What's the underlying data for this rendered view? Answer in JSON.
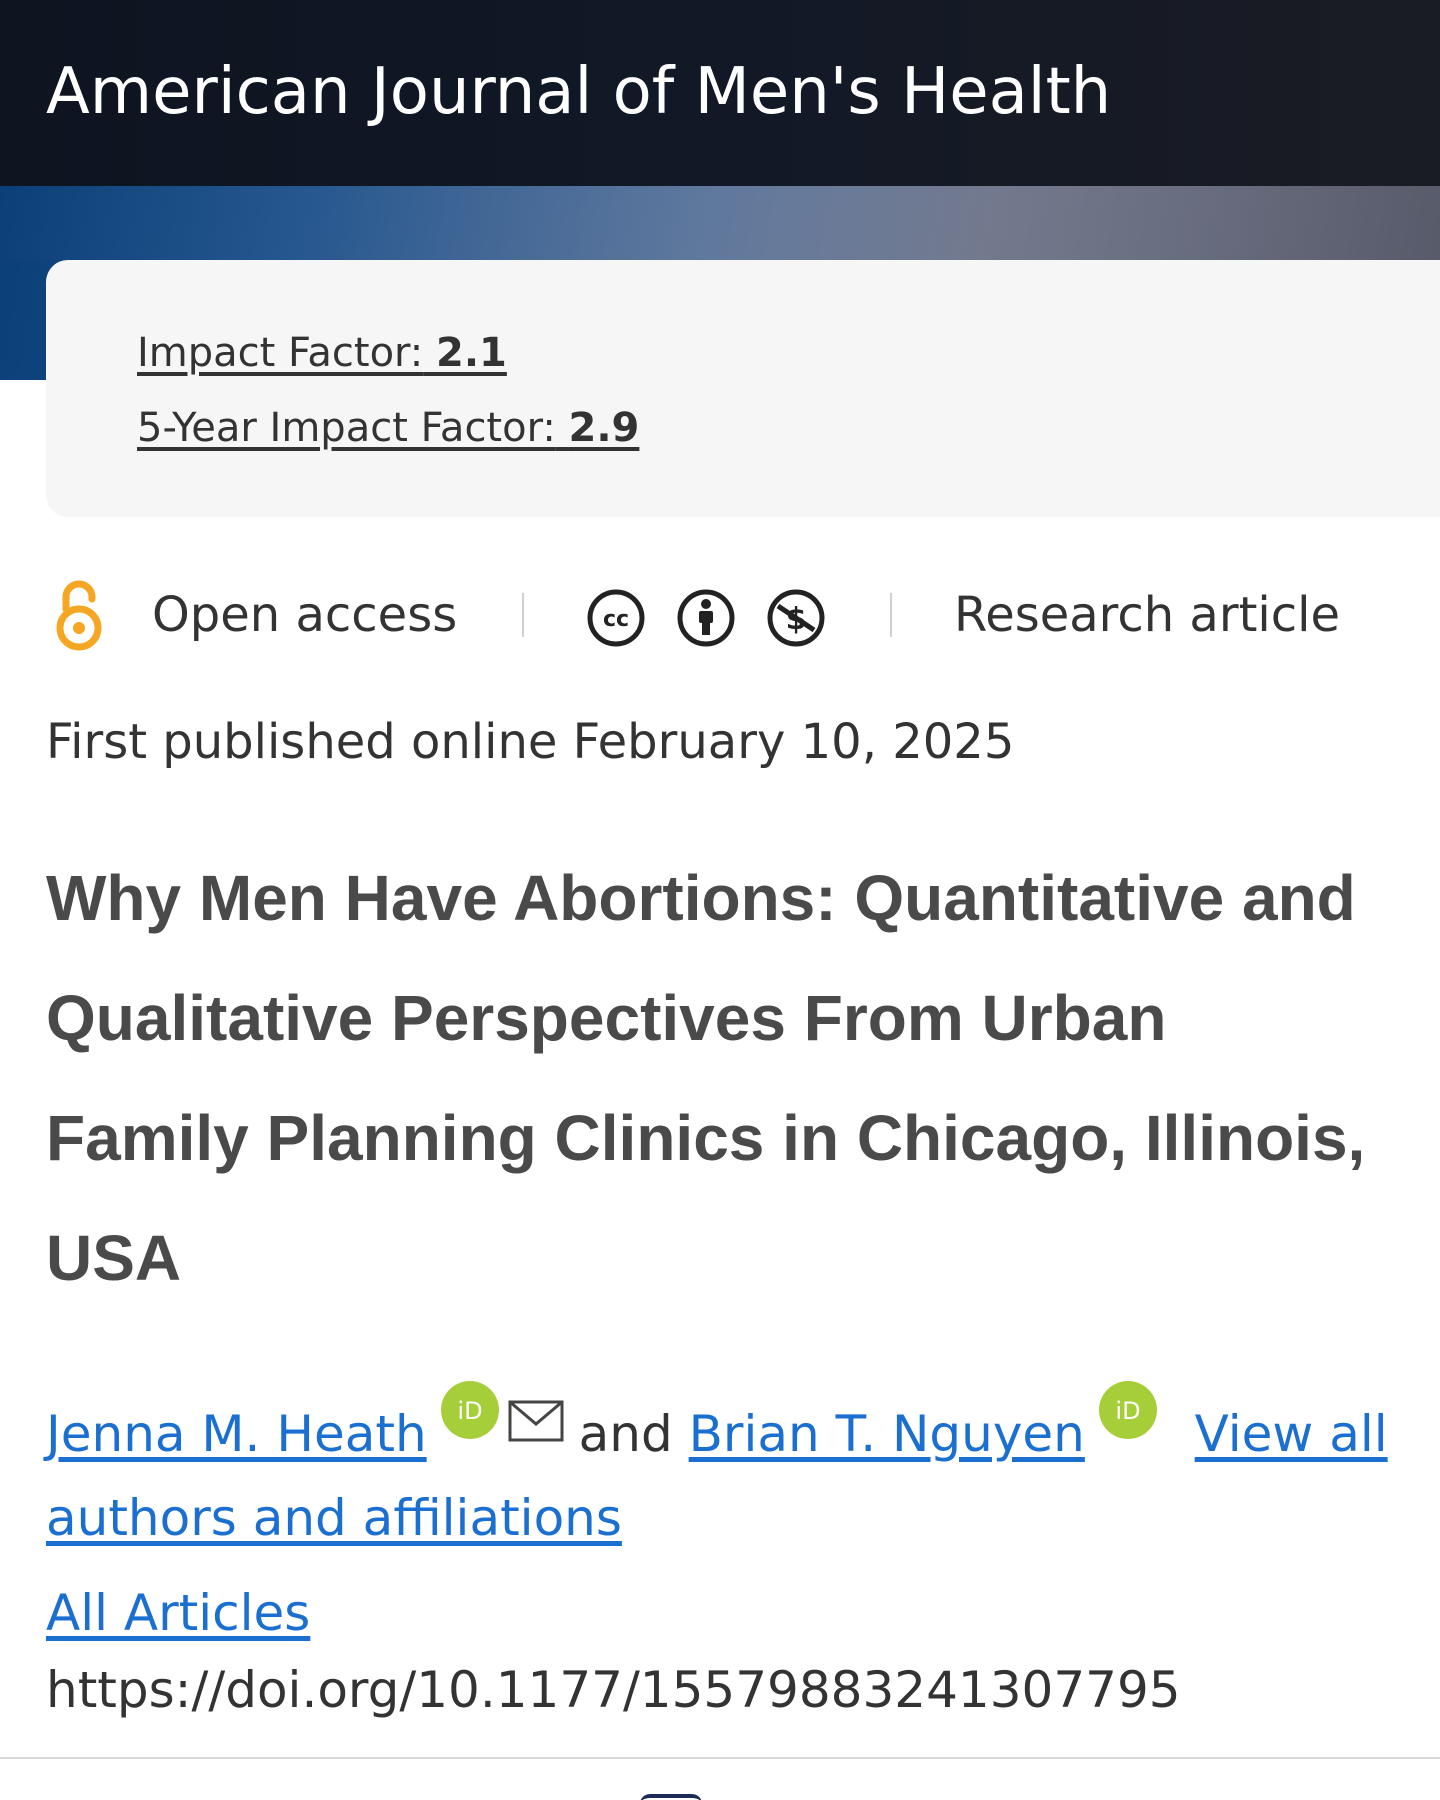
{
  "header": {
    "journal_title": "American Journal of Men's Health"
  },
  "metrics": {
    "impact_factor_label": "Impact Factor:",
    "impact_factor_value": "2.1",
    "five_year_label": "5-Year Impact Factor:",
    "five_year_value": "2.9"
  },
  "access": {
    "open_access_label": "Open access",
    "open_access_icon": "open-access-lock-icon",
    "license_icons": [
      "creative-commons-icon",
      "attribution-icon",
      "non-commercial-icon"
    ],
    "article_type": "Research article"
  },
  "publication": {
    "date_text": "First published online February 10, 2025"
  },
  "article": {
    "title_lines": [
      "Why Men Have Abortions: Quantitative and",
      "Qualitative Perspectives From Urban",
      "Family Planning Clinics in Chicago, Illinois,",
      "USA"
    ]
  },
  "authors": {
    "author_1": "Jenna M. Heath",
    "connector": "and",
    "author_2": "Brian T. Nguyen",
    "view_all_label": "View all authors and affiliations"
  },
  "links": {
    "all_articles": "All Articles",
    "doi": "https://doi.org/10.1177/15579883241307795"
  },
  "colors": {
    "header_bg": "#111826",
    "banner_blue": "#174e8a",
    "card_bg": "#f6f6f6",
    "link_blue": "#1a6fd0",
    "open_access_orange": "#f5a623",
    "orcid_green": "#a6ce39",
    "title_gray": "#4a4a4a"
  }
}
